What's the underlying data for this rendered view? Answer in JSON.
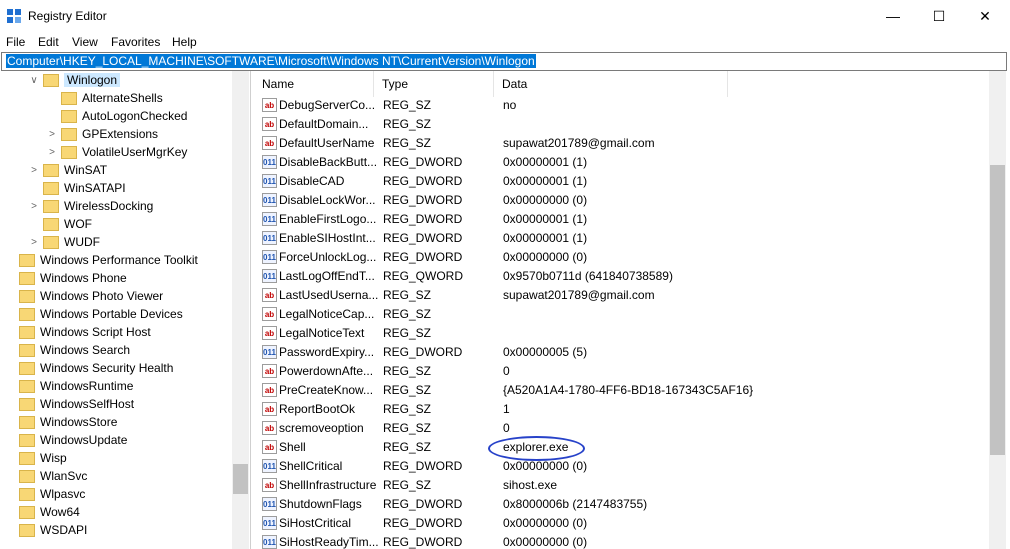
{
  "window": {
    "title": "Registry Editor",
    "minimize_glyph": "—",
    "maximize_glyph": "☐",
    "close_glyph": "✕",
    "icon": "registry-editor-icon"
  },
  "menu": [
    "File",
    "Edit",
    "View",
    "Favorites",
    "Help"
  ],
  "address": "Computer\\HKEY_LOCAL_MACHINE\\SOFTWARE\\Microsoft\\Windows NT\\CurrentVersion\\Winlogon",
  "tree": [
    {
      "label": "Winlogon",
      "chevron": "∨",
      "selected": true
    },
    {
      "label": "AlternateShells",
      "chevron": ""
    },
    {
      "label": "AutoLogonChecked",
      "chevron": ""
    },
    {
      "label": "GPExtensions",
      "chevron": ">"
    },
    {
      "label": "VolatileUserMgrKey",
      "chevron": ">"
    },
    {
      "label": "WinSAT",
      "chevron": ">"
    },
    {
      "label": "WinSATAPI",
      "chevron": ""
    },
    {
      "label": "WirelessDocking",
      "chevron": ">"
    },
    {
      "label": "WOF",
      "chevron": ""
    },
    {
      "label": "WUDF",
      "chevron": ">"
    },
    {
      "label": "Windows Performance Toolkit",
      "chevron": ""
    },
    {
      "label": "Windows Phone",
      "chevron": ""
    },
    {
      "label": "Windows Photo Viewer",
      "chevron": ""
    },
    {
      "label": "Windows Portable Devices",
      "chevron": ""
    },
    {
      "label": "Windows Script Host",
      "chevron": ""
    },
    {
      "label": "Windows Search",
      "chevron": ""
    },
    {
      "label": "Windows Security Health",
      "chevron": ""
    },
    {
      "label": "WindowsRuntime",
      "chevron": ""
    },
    {
      "label": "WindowsSelfHost",
      "chevron": ""
    },
    {
      "label": "WindowsStore",
      "chevron": ""
    },
    {
      "label": "WindowsUpdate",
      "chevron": ""
    },
    {
      "label": "Wisp",
      "chevron": ""
    },
    {
      "label": "WlanSvc",
      "chevron": ""
    },
    {
      "label": "Wlpasvc",
      "chevron": ""
    },
    {
      "label": "Wow64",
      "chevron": ""
    },
    {
      "label": "WSDAPI",
      "chevron": ""
    }
  ],
  "columns": {
    "name": "Name",
    "type": "Type",
    "data": "Data"
  },
  "rows": [
    {
      "name": "DebugServerCo...",
      "type": "REG_SZ",
      "data": "no",
      "icon": "ab"
    },
    {
      "name": "DefaultDomain...",
      "type": "REG_SZ",
      "data": "",
      "icon": "ab"
    },
    {
      "name": "DefaultUserName",
      "type": "REG_SZ",
      "data": "supawat201789@gmail.com",
      "icon": "ab"
    },
    {
      "name": "DisableBackButt...",
      "type": "REG_DWORD",
      "data": "0x00000001 (1)",
      "icon": "bin"
    },
    {
      "name": "DisableCAD",
      "type": "REG_DWORD",
      "data": "0x00000001 (1)",
      "icon": "bin"
    },
    {
      "name": "DisableLockWor...",
      "type": "REG_DWORD",
      "data": "0x00000000 (0)",
      "icon": "bin"
    },
    {
      "name": "EnableFirstLogo...",
      "type": "REG_DWORD",
      "data": "0x00000001 (1)",
      "icon": "bin"
    },
    {
      "name": "EnableSIHostInt...",
      "type": "REG_DWORD",
      "data": "0x00000001 (1)",
      "icon": "bin"
    },
    {
      "name": "ForceUnlockLog...",
      "type": "REG_DWORD",
      "data": "0x00000000 (0)",
      "icon": "bin"
    },
    {
      "name": "LastLogOffEndT...",
      "type": "REG_QWORD",
      "data": "0x9570b0711d (641840738589)",
      "icon": "bin"
    },
    {
      "name": "LastUsedUserna...",
      "type": "REG_SZ",
      "data": "supawat201789@gmail.com",
      "icon": "ab"
    },
    {
      "name": "LegalNoticeCap...",
      "type": "REG_SZ",
      "data": "",
      "icon": "ab"
    },
    {
      "name": "LegalNoticeText",
      "type": "REG_SZ",
      "data": "",
      "icon": "ab"
    },
    {
      "name": "PasswordExpiry...",
      "type": "REG_DWORD",
      "data": "0x00000005 (5)",
      "icon": "bin"
    },
    {
      "name": "PowerdownAfte...",
      "type": "REG_SZ",
      "data": "0",
      "icon": "ab"
    },
    {
      "name": "PreCreateKnow...",
      "type": "REG_SZ",
      "data": "{A520A1A4-1780-4FF6-BD18-167343C5AF16}",
      "icon": "ab"
    },
    {
      "name": "ReportBootOk",
      "type": "REG_SZ",
      "data": "1",
      "icon": "ab"
    },
    {
      "name": "scremoveoption",
      "type": "REG_SZ",
      "data": "0",
      "icon": "ab"
    },
    {
      "name": "Shell",
      "type": "REG_SZ",
      "data": "explorer.exe",
      "icon": "ab"
    },
    {
      "name": "ShellCritical",
      "type": "REG_DWORD",
      "data": "0x00000000 (0)",
      "icon": "bin"
    },
    {
      "name": "ShellInfrastructure",
      "type": "REG_SZ",
      "data": "sihost.exe",
      "icon": "ab"
    },
    {
      "name": "ShutdownFlags",
      "type": "REG_DWORD",
      "data": "0x8000006b (2147483755)",
      "icon": "bin"
    },
    {
      "name": "SiHostCritical",
      "type": "REG_DWORD",
      "data": "0x00000000 (0)",
      "icon": "bin"
    },
    {
      "name": "SiHostReadyTim...",
      "type": "REG_DWORD",
      "data": "0x00000000 (0)",
      "icon": "bin"
    }
  ],
  "icon_glyphs": {
    "ab": "ab",
    "bin": "011"
  },
  "colors": {
    "selection": "#0078d7",
    "annotation": "#2742c9",
    "folder": "#f8d775"
  }
}
